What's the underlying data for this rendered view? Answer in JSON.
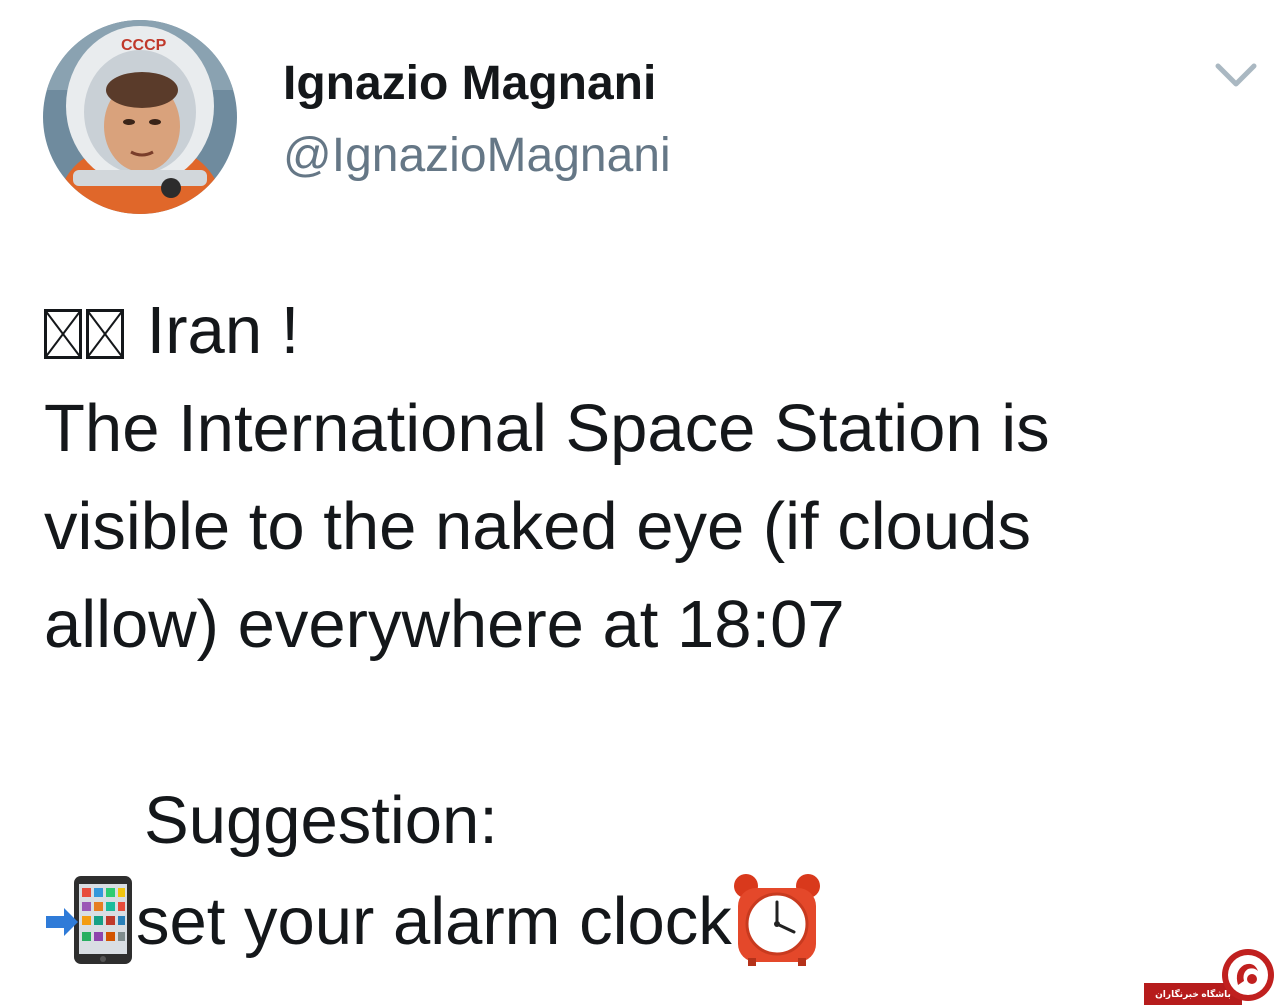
{
  "author": {
    "display_name": "Ignazio Magnani",
    "handle": "@IgnazioMagnani"
  },
  "menu": {
    "icon": "chevron-down-icon"
  },
  "tweet": {
    "line1": "Iran !",
    "line2": "The International Space Station is",
    "line3": "visible to the naked eye (if clouds",
    "line4": "allow) everywhere at 18:07",
    "suggestion": "Suggestion:",
    "alarm_text": "set your alarm clock"
  },
  "icons": {
    "flag": "missing-glyph-boxes",
    "phone": "mobile-phone-arrow-icon",
    "alarm": "alarm-clock-icon",
    "watermark_logo": "red-chat-bubble-logo"
  },
  "watermark": {
    "text": "باشگاه خبرنگاران"
  },
  "colors": {
    "text": "#14171a",
    "secondary": "#657786",
    "chevron": "#aab8c2",
    "watermark_red": "#b61c1c"
  }
}
